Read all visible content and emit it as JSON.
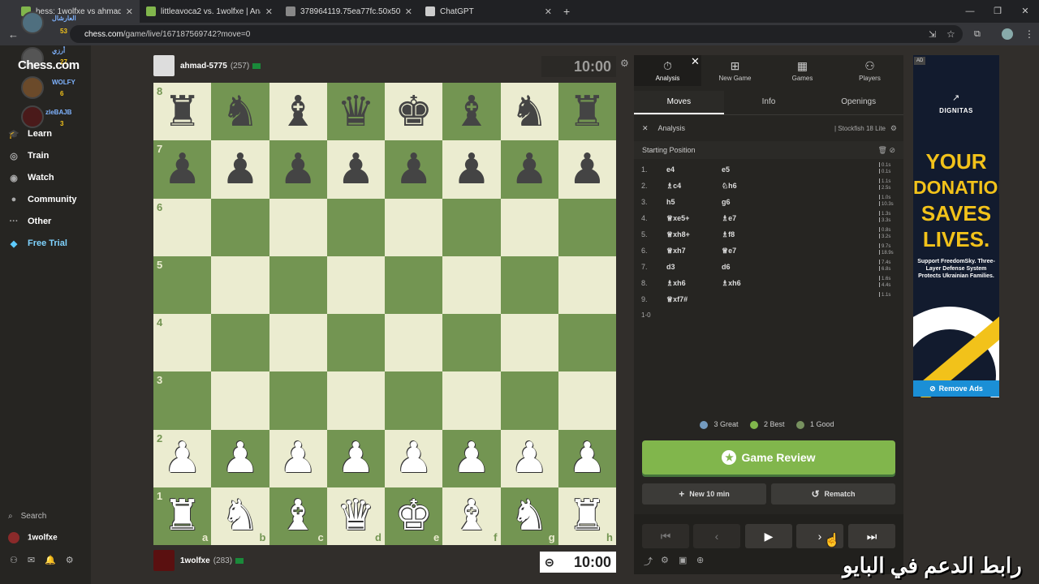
{
  "browser": {
    "tabs": [
      {
        "title": "hess: 1wolfxe vs ahmad-5",
        "favicon_color": "#81b64c"
      },
      {
        "title": "littleavoca2 vs. 1wolfxe | Analy",
        "favicon_color": "#81b64c"
      },
      {
        "title": "378964119.75ea77fc.50x50o.2c",
        "favicon_color": "#888888"
      },
      {
        "title": "ChatGPT",
        "favicon_color": "#cccccc"
      }
    ],
    "url_domain": "chess.com",
    "url_path": "/game/live/167187569742?move=0"
  },
  "sidebar": {
    "logo": "Chess.com",
    "overlay_users": [
      {
        "name": "العارشال",
        "score": "53"
      },
      {
        "name": "أرزي",
        "score": "27"
      },
      {
        "name": "WOLFY",
        "score": "6"
      },
      {
        "name": "zleBAJB",
        "score": "3"
      }
    ],
    "items": [
      {
        "label": "Learn",
        "icon": "graduation-cap-icon"
      },
      {
        "label": "Train",
        "icon": "target-icon"
      },
      {
        "label": "Watch",
        "icon": "binoculars-icon"
      },
      {
        "label": "Community",
        "icon": "people-icon"
      },
      {
        "label": "Other",
        "icon": "more-icon"
      },
      {
        "label": "Free Trial",
        "icon": "diamond-icon"
      }
    ],
    "search_label": "Search",
    "user_label": "1wolfxe"
  },
  "top_player": {
    "name": "ahmad-5775",
    "rating": "(257)",
    "clock": "10:00"
  },
  "bottom_player": {
    "name": "1wolfxe",
    "rating": "(283)",
    "clock": "10:00"
  },
  "board": {
    "ranks": [
      "8",
      "7",
      "6",
      "5",
      "4",
      "3",
      "2",
      "1"
    ],
    "files": [
      "a",
      "b",
      "c",
      "d",
      "e",
      "f",
      "g",
      "h"
    ],
    "rows": [
      [
        "♜",
        "♞",
        "♝",
        "♛",
        "♚",
        "♝",
        "♞",
        "♜"
      ],
      [
        "♟",
        "♟",
        "♟",
        "♟",
        "♟",
        "♟",
        "♟",
        "♟"
      ],
      [
        "",
        "",
        "",
        "",
        "",
        "",
        "",
        ""
      ],
      [
        "",
        "",
        "",
        "",
        "",
        "",
        "",
        ""
      ],
      [
        "",
        "",
        "",
        "",
        "",
        "",
        "",
        ""
      ],
      [
        "",
        "",
        "",
        "",
        "",
        "",
        "",
        ""
      ],
      [
        "♟",
        "♟",
        "♟",
        "♟",
        "♟",
        "♟",
        "♟",
        "♟"
      ],
      [
        "♜",
        "♞",
        "♝",
        "♛",
        "♚",
        "♝",
        "♞",
        "♜"
      ]
    ],
    "light_color": "#ebecd0",
    "dark_color": "#739552"
  },
  "panel": {
    "top_nav": [
      {
        "label": "Analysis",
        "icon": "stopwatch-icon"
      },
      {
        "label": "New Game",
        "icon": "plus-square-icon"
      },
      {
        "label": "Games",
        "icon": "board-icon"
      },
      {
        "label": "Players",
        "icon": "players-icon"
      }
    ],
    "sub_tabs": [
      "Moves",
      "Info",
      "Openings"
    ],
    "analysis_label": "Analysis",
    "engine_label": "| Stockfish 18 Lite",
    "starting_position": "Starting Position",
    "moves": [
      {
        "num": "1.",
        "white": "e4",
        "black": "e5",
        "t1": "0.1s",
        "t2": "0.1s"
      },
      {
        "num": "2.",
        "white": "♗c4",
        "black": "♘h6",
        "t1": "1.1s",
        "t2": "2.5s"
      },
      {
        "num": "3.",
        "white": "h5",
        "black": "g6",
        "t1": "1.0s",
        "t2": "10.3s"
      },
      {
        "num": "4.",
        "white": "♕xe5+",
        "black": "♗e7",
        "t1": "1.3s",
        "t2": "3.3s"
      },
      {
        "num": "5.",
        "white": "♕xh8+",
        "black": "♗f8",
        "t1": "0.8s",
        "t2": "3.2s"
      },
      {
        "num": "6.",
        "white": "♕xh7",
        "black": "♕e7",
        "t1": "9.7s",
        "t2": "18.9s"
      },
      {
        "num": "7.",
        "white": "d3",
        "black": "d6",
        "t1": "7.4s",
        "t2": "6.8s"
      },
      {
        "num": "8.",
        "white": "♗xh6",
        "black": "♗xh6",
        "t1": "1.6s",
        "t2": "4.4s"
      },
      {
        "num": "9.",
        "white": "♕xf7#",
        "black": "",
        "t1": "1.1s",
        "t2": ""
      }
    ],
    "result": "1-0",
    "summary": [
      {
        "label": "3 Great",
        "color": "#749bbf"
      },
      {
        "label": "2 Best",
        "color": "#81b64c"
      },
      {
        "label": "1 Good",
        "color": "#77915f"
      }
    ],
    "review_label": "Game Review",
    "new_label": "New 10 min",
    "rematch_label": "Rematch",
    "nav_buttons": [
      "⏮",
      "‹",
      "▶",
      "›",
      "⏭"
    ]
  },
  "ad": {
    "tag": "AD",
    "brand": "DIGNITAS",
    "headline": [
      "YOUR",
      "DONATION",
      "SAVES",
      "LIVES."
    ],
    "sub": "Support FreedomSky. Three-Layer Defense System Protects Ukrainian Families.",
    "remove": "Remove Ads"
  },
  "overlay_text": "رابط الدعم في البايو"
}
